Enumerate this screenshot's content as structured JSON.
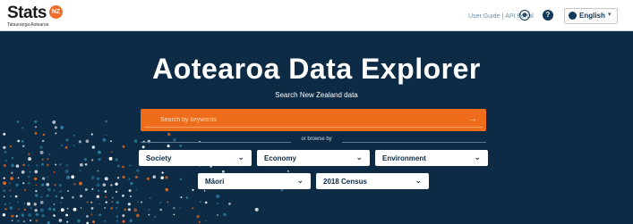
{
  "header": {
    "logo_text": "Stats",
    "logo_badge": "NZ",
    "logo_tagline": "Tatauranga Aotearoa",
    "links": [
      "User Guide",
      "API Portal"
    ],
    "link_separator": "|",
    "language": "English"
  },
  "hero": {
    "title": "Aotearoa Data Explorer",
    "subtitle": "Search New Zealand data",
    "search": {
      "placeholder": "Search by keywords",
      "value": ""
    },
    "browse_label": "or browse by",
    "categories_row1": [
      "Society",
      "Economy",
      "Environment"
    ],
    "categories_row2": [
      "Māori",
      "2018 Census"
    ]
  },
  "colors": {
    "background": "#0d2b45",
    "accent": "#ef6c1a",
    "dot_orange": "#ef6c1a",
    "dot_teal": "#2b7fa0",
    "dot_white": "#ffffff"
  }
}
